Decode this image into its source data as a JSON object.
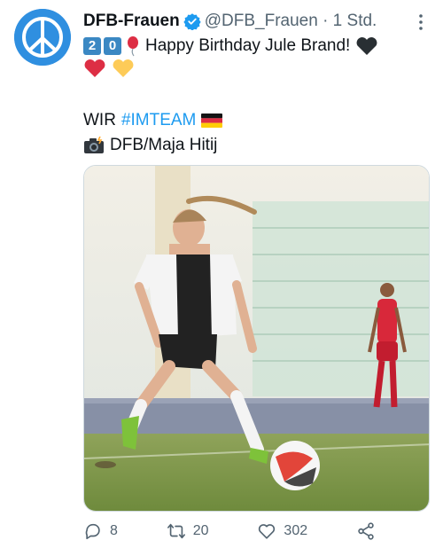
{
  "tweet": {
    "display_name": "DFB-Frauen",
    "handle_time": "@DFB_Frauen · 1 Std.",
    "birthday_digits": [
      "2",
      "0"
    ],
    "birthday_text": "Happy Birthday Jule Brand!",
    "wir_text": "WIR",
    "hashtag": "#IMTEAM",
    "photo_credit": "DFB/Maja Hitij"
  },
  "actions": {
    "replies": "8",
    "retweets": "20",
    "likes": "302"
  },
  "icons": {
    "avatar": "peace-sign-icon",
    "verified": "verified-badge-icon",
    "more": "more-dots-icon",
    "balloon": "balloon-icon",
    "hearts": [
      "black-heart-icon",
      "red-heart-icon",
      "yellow-heart-icon"
    ],
    "flag": "germany-flag-icon",
    "camera": "camera-flash-icon",
    "reply": "reply-icon",
    "retweet": "retweet-icon",
    "like": "like-icon",
    "share": "share-icon"
  },
  "colors": {
    "accent": "#1d9bf0",
    "avatar_bg": "#2f8fe0",
    "text_secondary": "#536471"
  }
}
